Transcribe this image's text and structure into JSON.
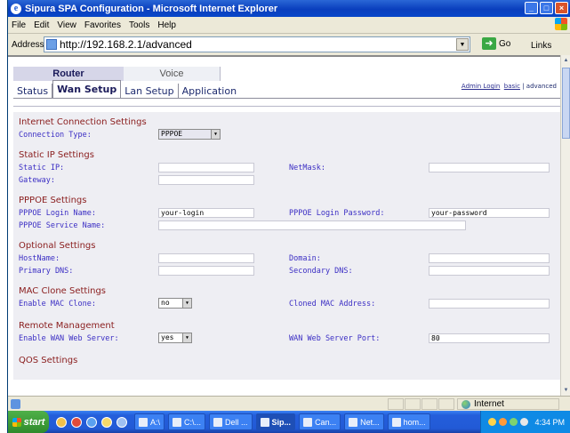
{
  "window": {
    "title": "Sipura SPA Configuration - Microsoft Internet Explorer",
    "controls": [
      "_",
      "□",
      "×"
    ]
  },
  "menubar": {
    "items": [
      "File",
      "Edit",
      "View",
      "Favorites",
      "Tools",
      "Help"
    ]
  },
  "addressbar": {
    "label": "Address",
    "url": "http://192.168.2.1/advanced",
    "go": "Go",
    "links": "Links"
  },
  "tabs": {
    "router": "Router",
    "voice": "Voice"
  },
  "subtabs": [
    "Status",
    "Wan Setup",
    "Lan Setup",
    "Application"
  ],
  "admin": {
    "admin_login": "Admin Login",
    "basic": "basic",
    "sep": "|",
    "advanced": "advanced"
  },
  "sections": {
    "internet": {
      "title": "Internet Connection Settings",
      "connection_type_label": "Connection Type:",
      "connection_type_value": "PPPOE"
    },
    "static": {
      "title": "Static IP Settings",
      "static_ip_label": "Static IP:",
      "static_ip_value": "",
      "netmask_label": "NetMask:",
      "netmask_value": "",
      "gateway_label": "Gateway:",
      "gateway_value": ""
    },
    "pppoe": {
      "title": "PPPOE Settings",
      "login_name_label": "PPPOE Login Name:",
      "login_name_value": "your-login",
      "password_label": "PPPOE Login Password:",
      "password_value": "your-password",
      "service_name_label": "PPPOE Service Name:",
      "service_name_value": ""
    },
    "optional": {
      "title": "Optional Settings",
      "hostname_label": "HostName:",
      "hostname_value": "",
      "domain_label": "Domain:",
      "domain_value": "",
      "primary_dns_label": "Primary DNS:",
      "primary_dns_value": "",
      "secondary_dns_label": "Secondary DNS:",
      "secondary_dns_value": ""
    },
    "mac": {
      "title": "MAC Clone Settings",
      "enable_label": "Enable MAC Clone:",
      "enable_value": "no",
      "cloned_label": "Cloned MAC Address:",
      "cloned_value": ""
    },
    "remote": {
      "title": "Remote Management",
      "enable_label": "Enable WAN Web Server:",
      "enable_value": "yes",
      "port_label": "WAN Web Server Port:",
      "port_value": "80"
    },
    "qos": {
      "title": "QOS Settings"
    }
  },
  "statusbar": {
    "zone": "Internet"
  },
  "taskbar": {
    "start": "start",
    "tasks": [
      "A:\\",
      "C:\\...",
      "Dell ...",
      "Sip...",
      "Can...",
      "Net...",
      "hom..."
    ],
    "clock": "4:34 PM"
  }
}
